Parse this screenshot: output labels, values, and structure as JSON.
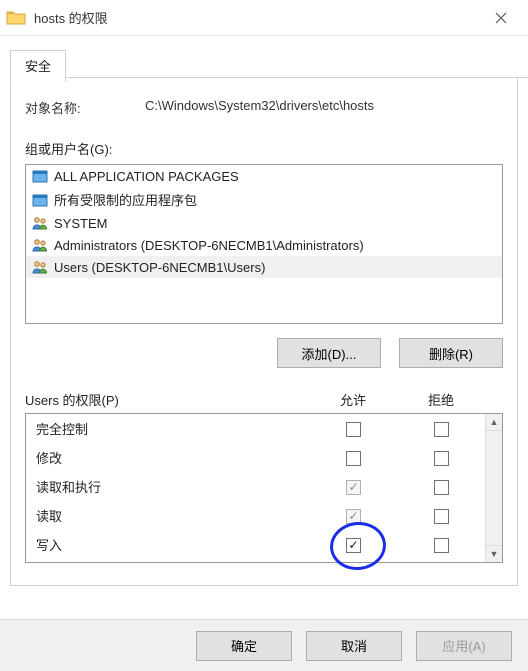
{
  "titlebar": {
    "title": "hosts 的权限"
  },
  "tabs": {
    "security": "安全"
  },
  "object": {
    "label": "对象名称:",
    "value": "C:\\Windows\\System32\\drivers\\etc\\hosts"
  },
  "groups": {
    "label": "组或用户名(G):",
    "items": [
      {
        "text": "ALL APPLICATION PACKAGES",
        "icon": "package"
      },
      {
        "text": "所有受限制的应用程序包",
        "icon": "package"
      },
      {
        "text": "SYSTEM",
        "icon": "users"
      },
      {
        "text": "Administrators (DESKTOP-6NECMB1\\Administrators)",
        "icon": "users"
      },
      {
        "text": "Users (DESKTOP-6NECMB1\\Users)",
        "icon": "users",
        "selected": true
      }
    ],
    "add_btn": "添加(D)...",
    "remove_btn": "删除(R)"
  },
  "permissions": {
    "label": "Users 的权限(P)",
    "col_allow": "允许",
    "col_deny": "拒绝",
    "rows": [
      {
        "name": "完全控制",
        "allow": "unchecked",
        "deny": "unchecked"
      },
      {
        "name": "修改",
        "allow": "unchecked",
        "deny": "unchecked"
      },
      {
        "name": "读取和执行",
        "allow": "grey-checked",
        "deny": "unchecked"
      },
      {
        "name": "读取",
        "allow": "grey-checked",
        "deny": "unchecked"
      },
      {
        "name": "写入",
        "allow": "checked",
        "deny": "unchecked"
      }
    ]
  },
  "footer": {
    "ok": "确定",
    "cancel": "取消",
    "apply": "应用(A)"
  }
}
